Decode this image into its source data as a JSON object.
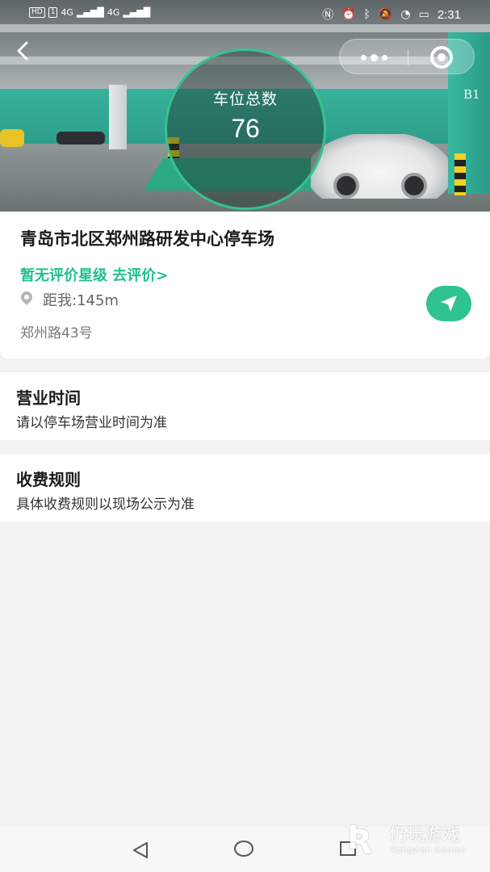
{
  "status_bar": {
    "left": [
      "HD",
      "1",
      "4G",
      "4G"
    ],
    "time": "2:31"
  },
  "hero": {
    "spots_label": "车位总数",
    "spots_total": "76",
    "sign": "B1"
  },
  "lot": {
    "name": "青岛市北区郑州路研发中心停车场",
    "rating": "暂无评价星级 去评价>",
    "distance": "距我:145m",
    "address": "郑州路43号"
  },
  "hours": {
    "title": "营业时间",
    "desc": "请以停车场营业时间为准"
  },
  "fees": {
    "title": "收费规则",
    "desc": "具体收费规则以现场公示为准"
  },
  "watermark": {
    "cn": "仍玩游戏",
    "en": "Rengwan Games"
  },
  "colors": {
    "accent": "#2fc48d",
    "rating_text": "#1fbf8f"
  }
}
